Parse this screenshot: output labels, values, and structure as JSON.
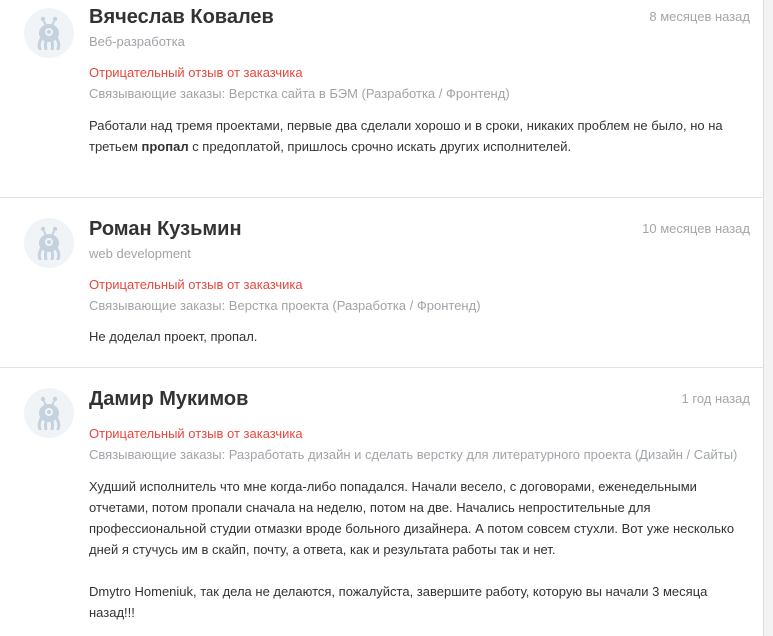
{
  "reviews": [
    {
      "name": "Вячеслав Ковалев",
      "date": "8 месяцев назад",
      "specialization": "Веб-разработка",
      "type": "Отрицательный отзыв от заказчика",
      "linked": "Связывающие заказы: Верстка сайта в БЭМ (Разработка / Фронтенд)",
      "text": {
        "part1": "Работали над тремя проектами, первые два сделали хорошо и в сроки, никаких проблем не было, но на третьем ",
        "bold": "пропал",
        "part2": " с предоплатой, пришлось срочно искать других исполнителей."
      }
    },
    {
      "name": "Роман Кузьмин",
      "date": "10 месяцев назад",
      "specialization": "web development",
      "type": "Отрицательный отзыв от заказчика",
      "linked": "Связывающие заказы: Верстка проекта (Разработка / Фронтенд)",
      "text": "Не доделал проект, пропал."
    },
    {
      "name": "Дамир Мукимов",
      "date": "1 год назад",
      "type": "Отрицательный отзыв от заказчика",
      "linked": "Связывающие заказы: Разработать дизайн и сделать верстку для литературного проекта (Дизайн / Сайты)",
      "text": {
        "p1": "Худший исполнитель что мне когда-либо попадался. Начали весело, с договорами, еженедельными отчетами, потом пропали сначала на неделю, потом на две. Начались непростительные для профессиональной студии отмазки вроде больного дизайнера. А потом совсем стухли. Вот уже несколько дней я стучусь им в скайп, почту, а ответа, как и результата работы так и нет.",
        "p2": "Dmytro Homeniuk, так дела не делаются, пожалуйста, завершите работу, которую вы начали 3 месяца назад!!!"
      }
    }
  ],
  "avatar_icon": "robot-mascot-icon",
  "colors": {
    "negative": "#e7473d",
    "muted": "#a0a4a8",
    "text": "#333333"
  }
}
